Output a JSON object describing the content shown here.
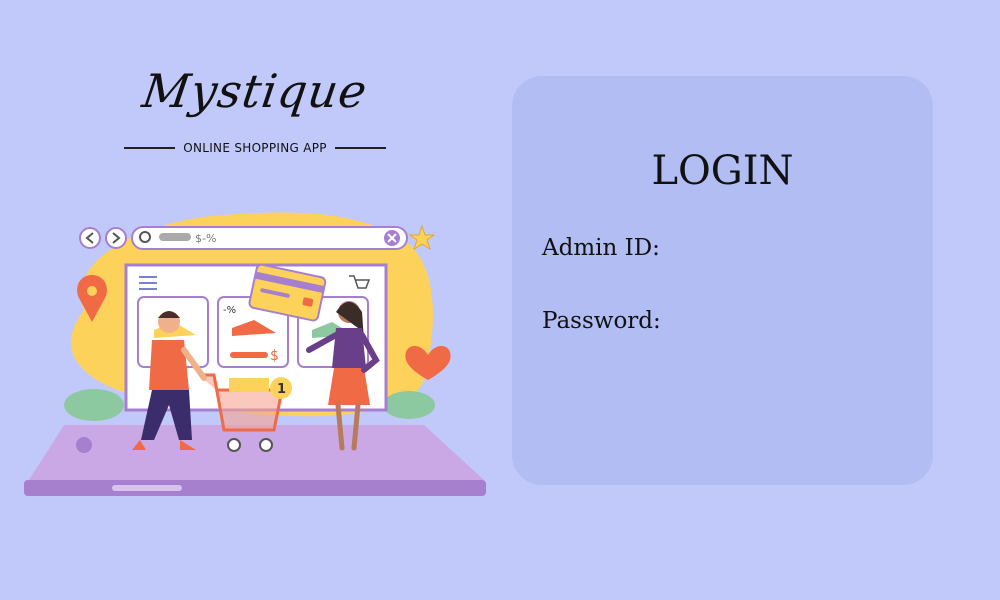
{
  "brand": {
    "name": "Mystique",
    "tagline": "ONLINE SHOPPING APP"
  },
  "illustration": {
    "search_text": "$-%",
    "discount_text": "-%",
    "price_text": "$",
    "cart_count": "1"
  },
  "login": {
    "title": "LOGIN",
    "admin_id_label": "Admin ID:",
    "admin_id_value": "",
    "password_label": "Password:",
    "password_value": ""
  },
  "colors": {
    "background": "#c0c9f9",
    "panel": "#b1bdf3",
    "text": "#111111"
  }
}
